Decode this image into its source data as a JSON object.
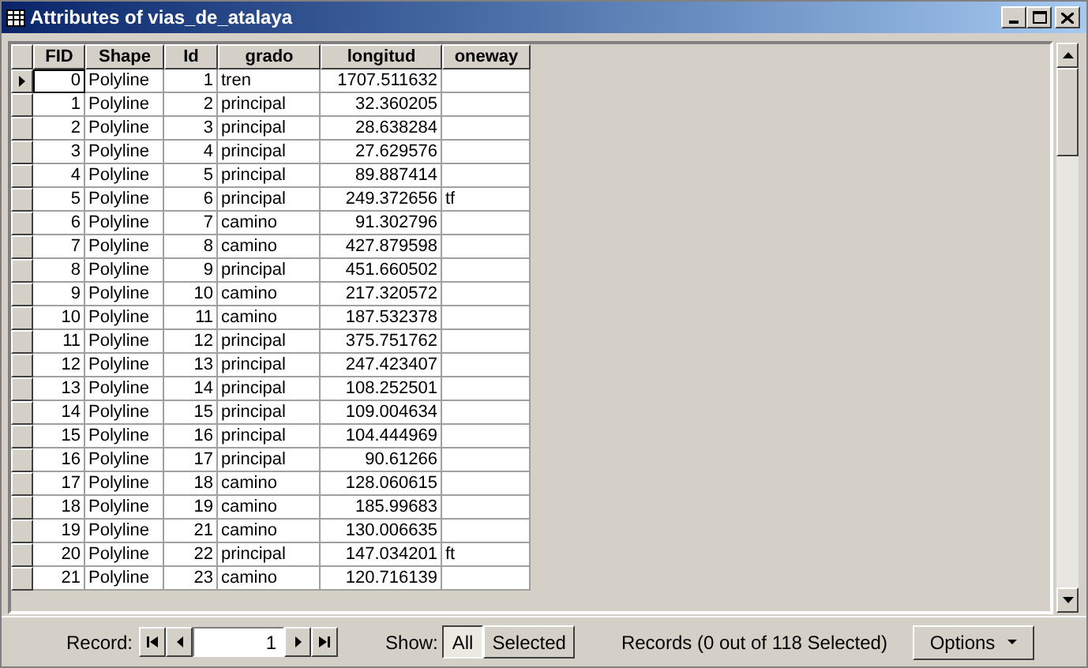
{
  "window": {
    "title": "Attributes of vias_de_atalaya"
  },
  "table": {
    "columns": [
      {
        "label": "FID"
      },
      {
        "label": "Shape"
      },
      {
        "label": "Id"
      },
      {
        "label": "grado"
      },
      {
        "label": "longitud"
      },
      {
        "label": "oneway"
      }
    ],
    "rows": [
      {
        "current": true,
        "cells": [
          "0",
          "Polyline",
          "1",
          "tren",
          "1707.511632",
          ""
        ]
      },
      {
        "current": false,
        "cells": [
          "1",
          "Polyline",
          "2",
          "principal",
          "32.360205",
          ""
        ]
      },
      {
        "current": false,
        "cells": [
          "2",
          "Polyline",
          "3",
          "principal",
          "28.638284",
          ""
        ]
      },
      {
        "current": false,
        "cells": [
          "3",
          "Polyline",
          "4",
          "principal",
          "27.629576",
          ""
        ]
      },
      {
        "current": false,
        "cells": [
          "4",
          "Polyline",
          "5",
          "principal",
          "89.887414",
          ""
        ]
      },
      {
        "current": false,
        "cells": [
          "5",
          "Polyline",
          "6",
          "principal",
          "249.372656",
          "tf"
        ]
      },
      {
        "current": false,
        "cells": [
          "6",
          "Polyline",
          "7",
          "camino",
          "91.302796",
          ""
        ]
      },
      {
        "current": false,
        "cells": [
          "7",
          "Polyline",
          "8",
          "camino",
          "427.879598",
          ""
        ]
      },
      {
        "current": false,
        "cells": [
          "8",
          "Polyline",
          "9",
          "principal",
          "451.660502",
          ""
        ]
      },
      {
        "current": false,
        "cells": [
          "9",
          "Polyline",
          "10",
          "camino",
          "217.320572",
          ""
        ]
      },
      {
        "current": false,
        "cells": [
          "10",
          "Polyline",
          "11",
          "camino",
          "187.532378",
          ""
        ]
      },
      {
        "current": false,
        "cells": [
          "11",
          "Polyline",
          "12",
          "principal",
          "375.751762",
          ""
        ]
      },
      {
        "current": false,
        "cells": [
          "12",
          "Polyline",
          "13",
          "principal",
          "247.423407",
          ""
        ]
      },
      {
        "current": false,
        "cells": [
          "13",
          "Polyline",
          "14",
          "principal",
          "108.252501",
          ""
        ]
      },
      {
        "current": false,
        "cells": [
          "14",
          "Polyline",
          "15",
          "principal",
          "109.004634",
          ""
        ]
      },
      {
        "current": false,
        "cells": [
          "15",
          "Polyline",
          "16",
          "principal",
          "104.444969",
          ""
        ]
      },
      {
        "current": false,
        "cells": [
          "16",
          "Polyline",
          "17",
          "principal",
          "90.61266",
          ""
        ]
      },
      {
        "current": false,
        "cells": [
          "17",
          "Polyline",
          "18",
          "camino",
          "128.060615",
          ""
        ]
      },
      {
        "current": false,
        "cells": [
          "18",
          "Polyline",
          "19",
          "camino",
          "185.99683",
          ""
        ]
      },
      {
        "current": false,
        "cells": [
          "19",
          "Polyline",
          "21",
          "camino",
          "130.006635",
          ""
        ]
      },
      {
        "current": false,
        "cells": [
          "20",
          "Polyline",
          "22",
          "principal",
          "147.034201",
          "ft"
        ]
      },
      {
        "current": false,
        "cells": [
          "21",
          "Polyline",
          "23",
          "camino",
          "120.716139",
          ""
        ]
      }
    ]
  },
  "footer": {
    "record_label": "Record:",
    "record_value": "1",
    "show_label": "Show:",
    "show_options": [
      {
        "label": "All",
        "selected": true
      },
      {
        "label": "Selected",
        "selected": false
      }
    ],
    "status": "Records (0 out of 118 Selected)",
    "options_button": "Options"
  }
}
